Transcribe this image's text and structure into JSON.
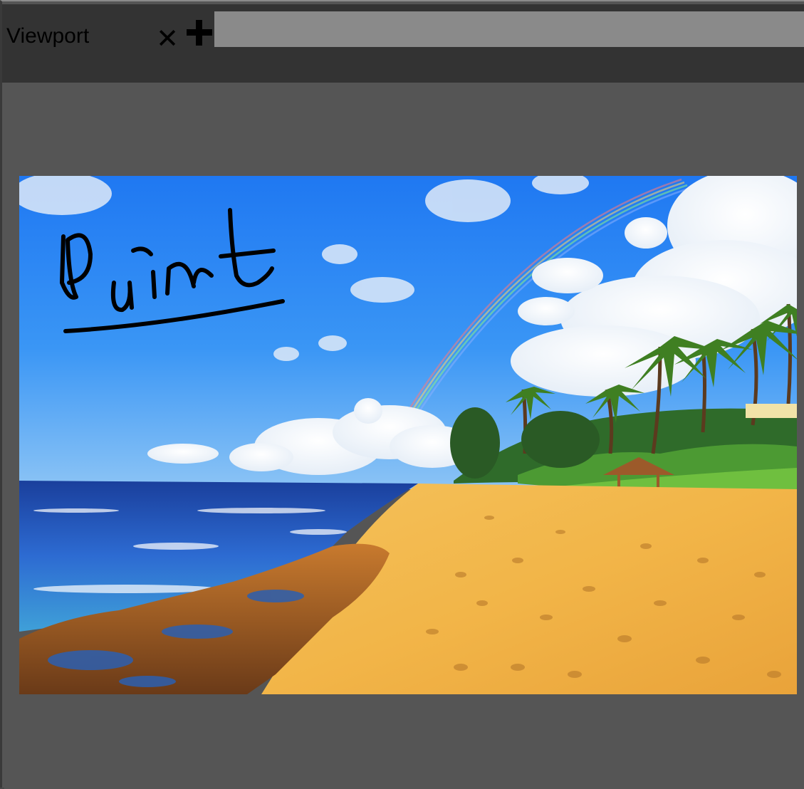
{
  "tabs": [
    {
      "label": "Viewport",
      "close_glyph": "✕"
    }
  ],
  "toolbar": {
    "add_tab_icon": "plus-icon",
    "close_tab_icon": "close-icon"
  },
  "canvas": {
    "image_subject": "beach-photo",
    "annotation_text": "Paint",
    "annotation_color": "#000000"
  },
  "colors": {
    "chrome_dark": "#333333",
    "chrome_mid": "#555555",
    "tab_strip": "#8a8a8a"
  }
}
